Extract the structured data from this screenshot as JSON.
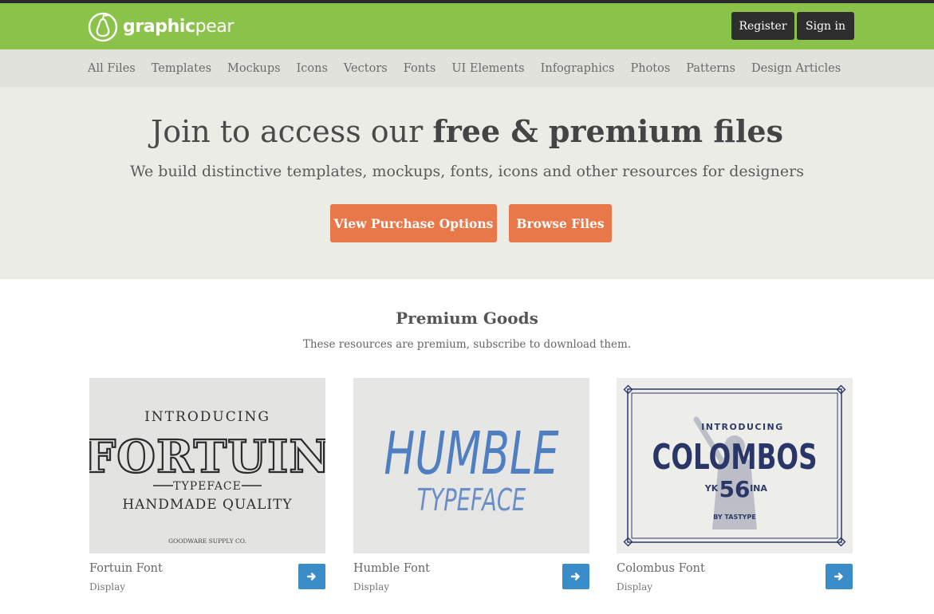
{
  "header": {
    "logo": {
      "bold": "graphic",
      "light": "pear",
      "icon": "pear-icon"
    },
    "register_label": "Register",
    "signin_label": "Sign in",
    "brand_color": "#8bc34a"
  },
  "nav": {
    "items": [
      {
        "label": "All Files"
      },
      {
        "label": "Templates"
      },
      {
        "label": "Mockups"
      },
      {
        "label": "Icons"
      },
      {
        "label": "Vectors"
      },
      {
        "label": "Fonts"
      },
      {
        "label": "UI Elements"
      },
      {
        "label": "Infographics"
      },
      {
        "label": "Photos"
      },
      {
        "label": "Patterns"
      },
      {
        "label": "Design Articles"
      }
    ]
  },
  "hero": {
    "title_light": "Join to access our ",
    "title_bold": "free & premium files",
    "subtitle": "We build distinctive templates, mockups, fonts, icons and other resources for designers",
    "purchase_label": "View Purchase Options",
    "browse_label": "Browse Files",
    "button_color": "#e8784a"
  },
  "premium": {
    "title": "Premium Goods",
    "subtitle": "These resources are premium, subscribe to download them.",
    "cards": [
      {
        "name": "Fortuin Font",
        "category": "Display",
        "thumb": {
          "line1": "INTRODUCING",
          "big": "FORTUIN",
          "line3": "TYPEFACE",
          "line4": "HANDMADE QUALITY",
          "footer": "GOODWARE SUPPLY CO."
        },
        "action_icon": "arrow-right-icon"
      },
      {
        "name": "Humble Font",
        "category": "Display",
        "thumb": {
          "big": "HUMBLE",
          "line2": "TYPEFACE"
        },
        "action_icon": "arrow-right-icon"
      },
      {
        "name": "Colombus Font",
        "category": "Display",
        "thumb": {
          "line1": "INTRODUCING",
          "big": "COLOMBOS",
          "left": "YK",
          "number": "56",
          "right": "INA",
          "footer": "BY TASTYPE"
        },
        "action_icon": "arrow-right-icon"
      }
    ]
  }
}
